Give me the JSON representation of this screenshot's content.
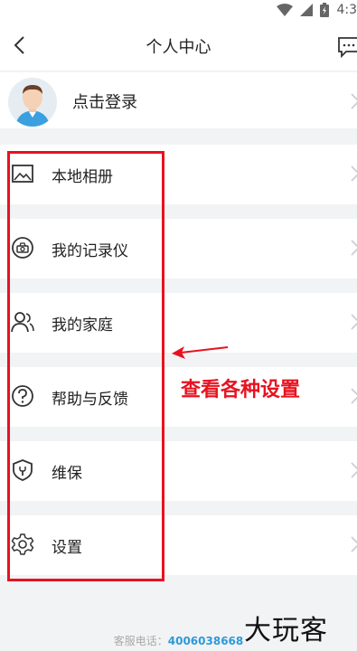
{
  "status_bar": {
    "time": "4:3"
  },
  "header": {
    "title": "个人中心"
  },
  "profile": {
    "login_label": "点击登录"
  },
  "menu": {
    "items": [
      {
        "label": "本地相册",
        "icon": "image-icon"
      },
      {
        "label": "我的记录仪",
        "icon": "dashcam-icon"
      },
      {
        "label": "我的家庭",
        "icon": "family-icon"
      },
      {
        "label": "帮助与反馈",
        "icon": "help-icon"
      },
      {
        "label": "维保",
        "icon": "shield-wrench-icon"
      },
      {
        "label": "设置",
        "icon": "gear-icon"
      }
    ]
  },
  "annotation": {
    "text": "查看各种设置",
    "color": "#e8121f"
  },
  "footer": {
    "service_label": "客服电话：",
    "phone": "4006038668"
  },
  "watermark": {
    "text": "大玩客"
  }
}
